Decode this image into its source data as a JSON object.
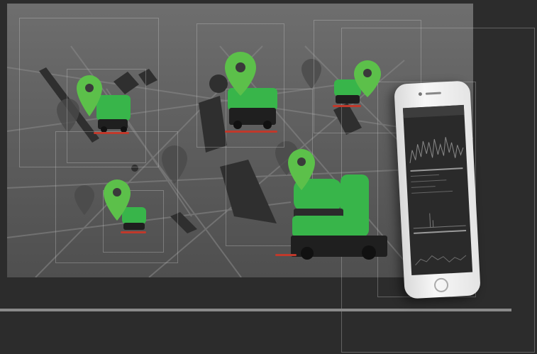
{
  "scene": {
    "map_color": "#666666",
    "accent_color": "#38b54a",
    "background_color": "#2c2c2c",
    "pins": [
      {
        "id": "pin-1",
        "icon": "location-pin-icon"
      },
      {
        "id": "pin-2",
        "icon": "location-pin-icon"
      },
      {
        "id": "pin-3",
        "icon": "location-pin-icon"
      },
      {
        "id": "pin-4",
        "icon": "location-pin-icon"
      },
      {
        "id": "pin-5",
        "icon": "location-pin-icon"
      }
    ],
    "machines": [
      {
        "id": "floor-scrubber-1"
      },
      {
        "id": "floor-scrubber-2"
      },
      {
        "id": "floor-scrubber-3"
      },
      {
        "id": "floor-scrubber-4"
      },
      {
        "id": "ride-on-scrubber"
      }
    ],
    "phone": {
      "icon": "smartphone-icon",
      "screen": "fleet-dashboard"
    }
  }
}
